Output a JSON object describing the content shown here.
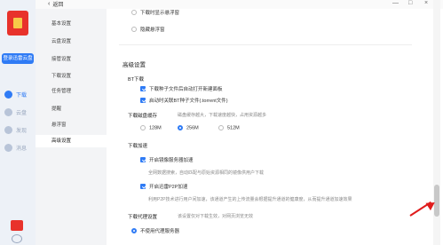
{
  "header": {
    "back_label": "返回",
    "minimize": "—",
    "maximize": "□",
    "close": "×"
  },
  "rail": {
    "login_label": "登录迅雷云盘",
    "items": [
      {
        "label": "下载",
        "active": true
      },
      {
        "label": "云盘"
      },
      {
        "label": "发现"
      },
      {
        "label": "消息"
      }
    ]
  },
  "nav": {
    "items": [
      {
        "label": "基本设置"
      },
      {
        "label": "云盘设置"
      },
      {
        "label": "接管设置"
      },
      {
        "label": "下载设置"
      },
      {
        "label": "任务管理"
      },
      {
        "label": "提醒"
      },
      {
        "label": "悬浮窗"
      },
      {
        "label": "高级设置",
        "active": true
      }
    ]
  },
  "content": {
    "top_option_partial": "下载时显示悬浮窗",
    "hide_float_label": "隐藏悬浮窗",
    "advanced_title": "高级设置",
    "bt": {
      "title": "BT下载",
      "opt1": "下载种子文件后自动打开新建面板",
      "opt2": "启动时关联BT种子文件(.torrent文件)"
    },
    "cache": {
      "title": "下载磁盘缓存",
      "hint": "磁盘缓存越大，下载速度越快，占用资源越多",
      "options": [
        "128M",
        "256M",
        "512M"
      ],
      "selected": "256M"
    },
    "accel": {
      "title": "下载加速",
      "mirror_label": "开启镜像服务器加速",
      "mirror_hint": "全网数据搜索，自动匹配与原始资源相同的镜像供用户下载",
      "p2p_label": "开启迅雷P2P加速",
      "p2p_hint": "利用P2P技术进行用户间加速，该通道产生的上传流量会根据提升通道的健康度，从而提升通道加速效果"
    },
    "proxy": {
      "title": "下载代理设置",
      "hint": "该设置仅对下载生效，对网页浏览无效",
      "no_proxy_label": "不使用代理服务器"
    }
  },
  "colors": {
    "accent": "#2f7bf5",
    "annotation_arrow": "#e01c1c",
    "brand_red": "#e8322b"
  }
}
